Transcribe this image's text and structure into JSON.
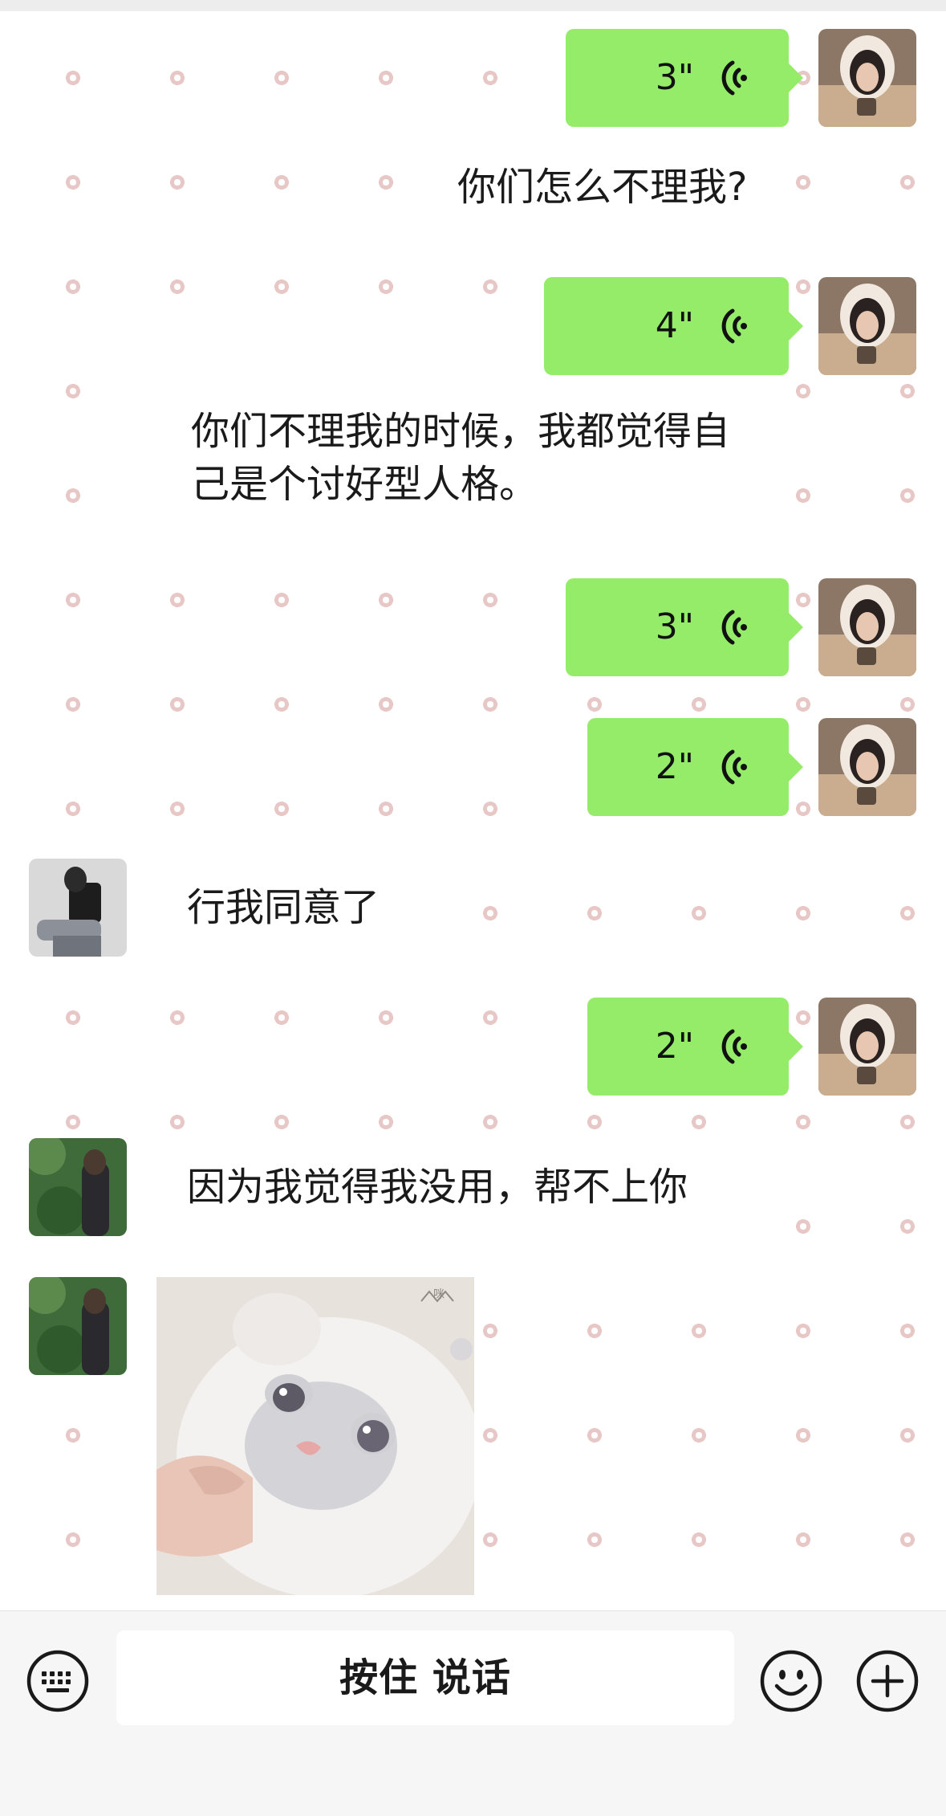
{
  "messages": [
    {
      "type": "voice",
      "side": "right",
      "duration": "3\""
    },
    {
      "type": "text",
      "side": "right",
      "text": "你们怎么不理我?"
    },
    {
      "type": "voice",
      "side": "right",
      "duration": "4\""
    },
    {
      "type": "text",
      "side": "right",
      "lines": [
        "你们不理我的时候，我都觉得自",
        "己是个讨好型人格。"
      ]
    },
    {
      "type": "voice",
      "side": "right",
      "duration": "3\""
    },
    {
      "type": "voice",
      "side": "right",
      "duration": "2\""
    },
    {
      "type": "text",
      "side": "left",
      "text": "行我同意了"
    },
    {
      "type": "voice",
      "side": "right",
      "duration": "2\""
    },
    {
      "type": "text",
      "side": "left",
      "text": "因为我觉得我没用，帮不上你"
    },
    {
      "type": "sticker",
      "side": "left",
      "sticker_name": "cat-sticker-image",
      "watermark": "咪"
    }
  ],
  "input_bar": {
    "talk_label": "按住 说话",
    "left_icon": "keyboard-icon",
    "right_icons": [
      "emoji-icon",
      "plus-icon"
    ]
  },
  "colors": {
    "voice_bubble": "#95ec69",
    "text_bubble": "#ffffff",
    "input_bar_bg": "#f6f6f6",
    "wallpaper_dot": "#e8c8c6"
  }
}
